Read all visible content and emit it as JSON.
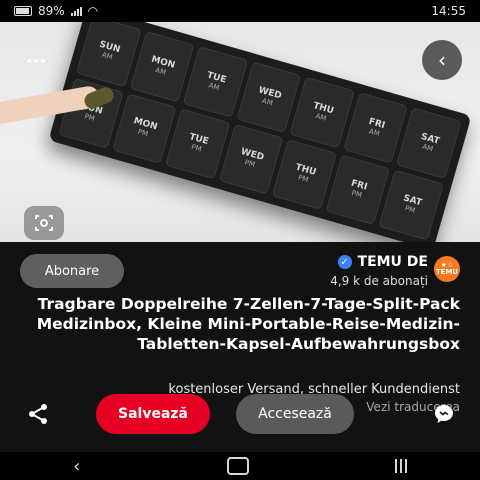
{
  "status_bar": {
    "time": "14:55",
    "battery": "89%",
    "icons": [
      "battery-icon",
      "signal-icon",
      "wifi-icon"
    ]
  },
  "hero": {
    "buttons": {
      "more_icon": "more-icon",
      "back_icon": "back-arrow-icon",
      "lens_icon": "visual-search-icon"
    },
    "pillbox_labels": [
      {
        "day": "SUN",
        "sub": "AM"
      },
      {
        "day": "MON",
        "sub": "AM"
      },
      {
        "day": "TUE",
        "sub": "AM"
      },
      {
        "day": "WED",
        "sub": "AM"
      },
      {
        "day": "THU",
        "sub": "AM"
      },
      {
        "day": "FRI",
        "sub": "AM"
      },
      {
        "day": "SAT",
        "sub": "AM"
      },
      {
        "day": "SUN",
        "sub": "PM"
      },
      {
        "day": "MON",
        "sub": "PM"
      },
      {
        "day": "TUE",
        "sub": "PM"
      },
      {
        "day": "WED",
        "sub": "PM"
      },
      {
        "day": "THU",
        "sub": "PM"
      },
      {
        "day": "FRI",
        "sub": "PM"
      },
      {
        "day": "SAT",
        "sub": "PM"
      }
    ]
  },
  "store": {
    "logo_text_1": "★☆",
    "logo_text_2": "TEMU",
    "name": "TEMU DE",
    "followers": "4,9 k de abonați",
    "subscribe_label": "Abonare"
  },
  "product": {
    "title": "Tragbare Doppelreihe 7-Zellen-7-Tage-Split-Pack Medizinbox, Kleine Mini-Portable-Reise-Medizin-Tabletten-Kapsel-Aufbewahrungsbox",
    "shipping": "kostenloser Versand, schneller Kundendienst",
    "translate_label": "Vezi traducerea"
  },
  "actions": {
    "save_label": "Salvează",
    "visit_label": "Accesează",
    "share_icon": "share-icon",
    "chat_icon": "chat-icon"
  },
  "colors": {
    "accent": "#e60023",
    "secondary": "#5a5a5a",
    "background": "#121212"
  }
}
